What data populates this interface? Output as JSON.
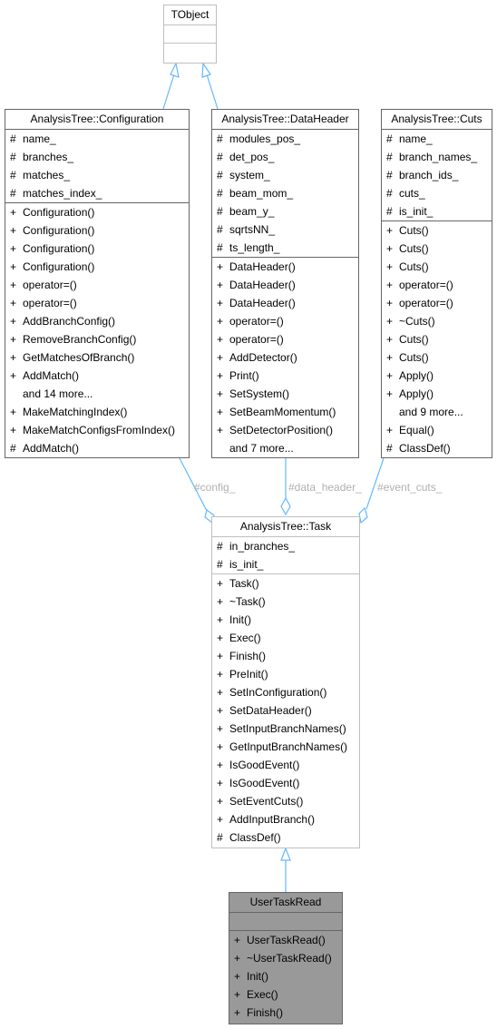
{
  "colors": {
    "edge": "#63b8ff",
    "border": "#666666",
    "light_border": "#bfbfbf",
    "focus_fill": "#999999",
    "label": "#b0b0b0"
  },
  "classes": {
    "tobject": {
      "name": "TObject",
      "attributes": [],
      "methods": []
    },
    "configuration": {
      "name": "AnalysisTree::Configuration",
      "attributes": [
        {
          "vis": "#",
          "name": "name_"
        },
        {
          "vis": "#",
          "name": "branches_"
        },
        {
          "vis": "#",
          "name": "matches_"
        },
        {
          "vis": "#",
          "name": "matches_index_"
        }
      ],
      "methods": [
        {
          "vis": "+",
          "name": "Configuration()"
        },
        {
          "vis": "+",
          "name": "Configuration()"
        },
        {
          "vis": "+",
          "name": "Configuration()"
        },
        {
          "vis": "+",
          "name": "Configuration()"
        },
        {
          "vis": "+",
          "name": "operator=()"
        },
        {
          "vis": "+",
          "name": "operator=()"
        },
        {
          "vis": "+",
          "name": "AddBranchConfig()"
        },
        {
          "vis": "+",
          "name": "RemoveBranchConfig()"
        },
        {
          "vis": "+",
          "name": "GetMatchesOfBranch()"
        },
        {
          "vis": "+",
          "name": "AddMatch()"
        },
        {
          "vis": "",
          "name": "and 14 more..."
        },
        {
          "vis": "+",
          "name": "MakeMatchingIndex()"
        },
        {
          "vis": "+",
          "name": "MakeMatchConfigsFromIndex()"
        },
        {
          "vis": "#",
          "name": "AddMatch()"
        }
      ]
    },
    "dataheader": {
      "name": "AnalysisTree::DataHeader",
      "attributes": [
        {
          "vis": "#",
          "name": "modules_pos_"
        },
        {
          "vis": "#",
          "name": "det_pos_"
        },
        {
          "vis": "#",
          "name": "system_"
        },
        {
          "vis": "#",
          "name": "beam_mom_"
        },
        {
          "vis": "#",
          "name": "beam_y_"
        },
        {
          "vis": "#",
          "name": "sqrtsNN_"
        },
        {
          "vis": "#",
          "name": "ts_length_"
        }
      ],
      "methods": [
        {
          "vis": "+",
          "name": "DataHeader()"
        },
        {
          "vis": "+",
          "name": "DataHeader()"
        },
        {
          "vis": "+",
          "name": "DataHeader()"
        },
        {
          "vis": "+",
          "name": "operator=()"
        },
        {
          "vis": "+",
          "name": "operator=()"
        },
        {
          "vis": "+",
          "name": "AddDetector()"
        },
        {
          "vis": "+",
          "name": "Print()"
        },
        {
          "vis": "+",
          "name": "SetSystem()"
        },
        {
          "vis": "+",
          "name": "SetBeamMomentum()"
        },
        {
          "vis": "+",
          "name": "SetDetectorPosition()"
        },
        {
          "vis": "",
          "name": "and 7 more..."
        }
      ]
    },
    "cuts": {
      "name": "AnalysisTree::Cuts",
      "attributes": [
        {
          "vis": "#",
          "name": "name_"
        },
        {
          "vis": "#",
          "name": "branch_names_"
        },
        {
          "vis": "#",
          "name": "branch_ids_"
        },
        {
          "vis": "#",
          "name": "cuts_"
        },
        {
          "vis": "#",
          "name": "is_init_"
        }
      ],
      "methods": [
        {
          "vis": "+",
          "name": "Cuts()"
        },
        {
          "vis": "+",
          "name": "Cuts()"
        },
        {
          "vis": "+",
          "name": "Cuts()"
        },
        {
          "vis": "+",
          "name": "operator=()"
        },
        {
          "vis": "+",
          "name": "operator=()"
        },
        {
          "vis": "+",
          "name": "~Cuts()"
        },
        {
          "vis": "+",
          "name": "Cuts()"
        },
        {
          "vis": "+",
          "name": "Cuts()"
        },
        {
          "vis": "+",
          "name": "Apply()"
        },
        {
          "vis": "+",
          "name": "Apply()"
        },
        {
          "vis": "",
          "name": "and 9 more..."
        },
        {
          "vis": "+",
          "name": "Equal()"
        },
        {
          "vis": "#",
          "name": "ClassDef()"
        }
      ]
    },
    "task": {
      "name": "AnalysisTree::Task",
      "attributes": [
        {
          "vis": "#",
          "name": "in_branches_"
        },
        {
          "vis": "#",
          "name": "is_init_"
        }
      ],
      "methods": [
        {
          "vis": "+",
          "name": "Task()"
        },
        {
          "vis": "+",
          "name": "~Task()"
        },
        {
          "vis": "+",
          "name": "Init()"
        },
        {
          "vis": "+",
          "name": "Exec()"
        },
        {
          "vis": "+",
          "name": "Finish()"
        },
        {
          "vis": "+",
          "name": "PreInit()"
        },
        {
          "vis": "+",
          "name": "SetInConfiguration()"
        },
        {
          "vis": "+",
          "name": "SetDataHeader()"
        },
        {
          "vis": "+",
          "name": "SetInputBranchNames()"
        },
        {
          "vis": "+",
          "name": "GetInputBranchNames()"
        },
        {
          "vis": "+",
          "name": "IsGoodEvent()"
        },
        {
          "vis": "+",
          "name": "IsGoodEvent()"
        },
        {
          "vis": "+",
          "name": "SetEventCuts()"
        },
        {
          "vis": "+",
          "name": "AddInputBranch()"
        },
        {
          "vis": "#",
          "name": "ClassDef()"
        }
      ]
    },
    "usertaskread": {
      "name": "UserTaskRead",
      "attributes": [],
      "methods": [
        {
          "vis": "+",
          "name": "UserTaskRead()"
        },
        {
          "vis": "+",
          "name": "~UserTaskRead()"
        },
        {
          "vis": "+",
          "name": "Init()"
        },
        {
          "vis": "+",
          "name": "Exec()"
        },
        {
          "vis": "+",
          "name": "Finish()"
        }
      ]
    }
  },
  "edges": {
    "config_label": "#config_",
    "data_header_label": "#data_header_",
    "event_cuts_label": "#event_cuts_"
  }
}
